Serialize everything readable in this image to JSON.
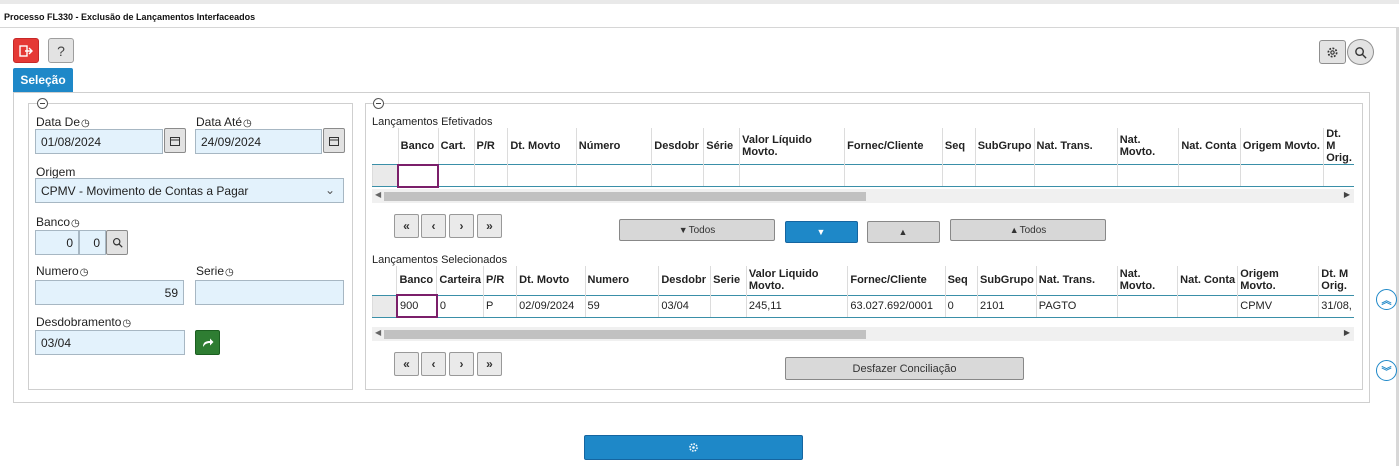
{
  "window": {
    "title": "Processo FL330 - Exclusão de Lançamentos Interfaceados"
  },
  "toolbar": {
    "exit_icon": "exit-icon",
    "help_label": "?",
    "settings_icon": "gear-icon",
    "search_icon": "search-icon"
  },
  "tabs": [
    {
      "label": "Seleção",
      "active": true
    }
  ],
  "form": {
    "data_de": {
      "label": "Data De",
      "value": "01/08/2024"
    },
    "data_ate": {
      "label": "Data Até",
      "value": "24/09/2024"
    },
    "origem": {
      "label": "Origem",
      "value": "CPMV - Movimento de Contas a Pagar"
    },
    "banco": {
      "label": "Banco",
      "value1": "0",
      "value2": "0"
    },
    "numero": {
      "label": "Numero",
      "value": "59"
    },
    "serie": {
      "label": "Serie",
      "value": ""
    },
    "desdobramento": {
      "label": "Desdobramento",
      "value": "03/04"
    }
  },
  "efetivados": {
    "title": "Lançamentos Efetivados",
    "columns": [
      "Banco",
      "Cart.",
      "P/R",
      "Dt. Movto",
      "Número",
      "Desdobr",
      "Série",
      "Valor Líquido Movto.",
      "Fornec/Cliente",
      "Seq",
      "SubGrupo",
      "Nat. Trans.",
      "Nat. Movto.",
      "Nat. Conta",
      "Origem Movto.",
      "Dt. M Orig."
    ],
    "rows": [
      [
        "",
        "",
        "",
        "",
        "",
        "",
        "",
        "",
        "",
        "",
        "",
        "",
        "",
        "",
        "",
        ""
      ]
    ],
    "pager": [
      "«",
      "‹",
      "›",
      "»"
    ],
    "actions": {
      "todos_left": "Todos",
      "todos_right": "Todos"
    }
  },
  "selecionados": {
    "title": "Lançamentos Selecionados",
    "columns": [
      "Banco",
      "Carteira",
      "P/R",
      "Dt. Movto",
      "Numero",
      "Desdobr",
      "Serie",
      "Valor Liquido Movto.",
      "Fornec/Cliente",
      "Seq",
      "SubGrupo",
      "Nat. Trans.",
      "Nat. Movto.",
      "Nat. Conta",
      "Origem Movto.",
      "Dt. M Orig."
    ],
    "rows": [
      [
        "900",
        "0",
        "P",
        "02/09/2024",
        "59",
        "03/04",
        "",
        "245,11",
        "63.027.692/0001",
        "0",
        "2101",
        "PAGTO",
        "",
        "",
        "CPMV",
        "31/08,"
      ]
    ],
    "pager": [
      "«",
      "‹",
      "›",
      "»"
    ],
    "desfazer_label": "Desfazer Conciliação"
  },
  "colors": {
    "accent": "#1e88c8",
    "exit": "#e53935",
    "go": "#2e7d32",
    "input_bg": "#e3f2fc"
  }
}
